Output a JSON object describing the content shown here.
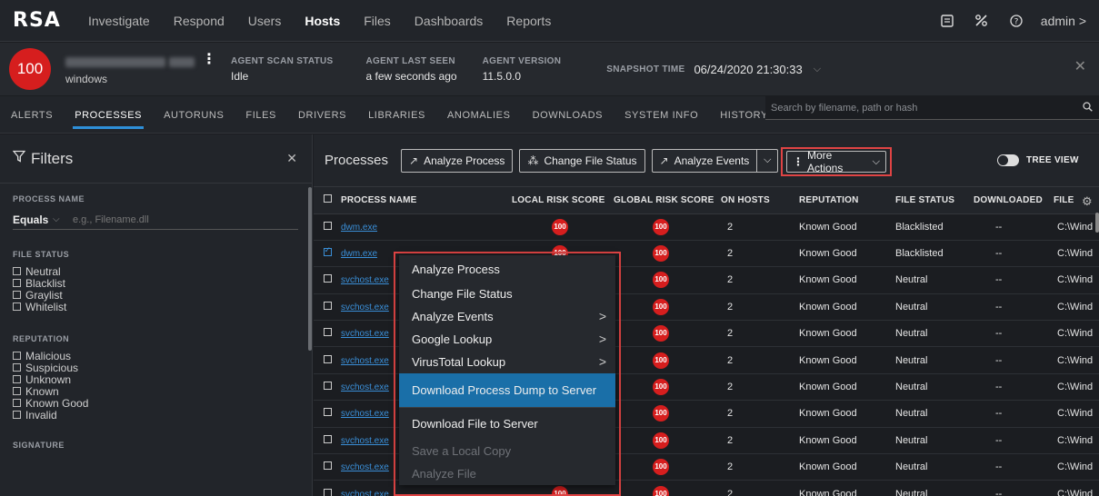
{
  "app": {
    "logo": "RSA",
    "nav": [
      "Investigate",
      "Respond",
      "Users",
      "Hosts",
      "Files",
      "Dashboards",
      "Reports"
    ],
    "active_nav": "Hosts",
    "user": "admin >"
  },
  "host": {
    "risk_score": "100",
    "os": "windows",
    "agent_scan_status": {
      "label": "AGENT SCAN STATUS",
      "value": "Idle"
    },
    "agent_last_seen": {
      "label": "AGENT LAST SEEN",
      "value": "a few seconds ago"
    },
    "agent_version": {
      "label": "AGENT VERSION",
      "value": "11.5.0.0"
    },
    "snapshot": {
      "label": "SNAPSHOT TIME",
      "value": "06/24/2020 21:30:33"
    }
  },
  "tabs": [
    "ALERTS",
    "PROCESSES",
    "AUTORUNS",
    "FILES",
    "DRIVERS",
    "LIBRARIES",
    "ANOMALIES",
    "DOWNLOADS",
    "SYSTEM INFO",
    "HISTORY"
  ],
  "active_tab": "PROCESSES",
  "search": {
    "placeholder": "Search by filename, path or hash"
  },
  "filters": {
    "title": "Filters",
    "process_name": {
      "label": "PROCESS NAME",
      "operator": "Equals",
      "placeholder": "e.g., Filename.dll"
    },
    "file_status": {
      "label": "FILE STATUS",
      "options": [
        "Neutral",
        "Blacklist",
        "Graylist",
        "Whitelist"
      ]
    },
    "reputation": {
      "label": "REPUTATION",
      "options": [
        "Malicious",
        "Suspicious",
        "Unknown",
        "Known",
        "Known Good",
        "Invalid"
      ]
    },
    "signature_label": "SIGNATURE"
  },
  "processes": {
    "title": "Processes",
    "buttons": {
      "analyze_process": "Analyze Process",
      "change_file_status": "Change File Status",
      "analyze_events": "Analyze Events",
      "more_actions": "More Actions"
    },
    "tree_view": "TREE VIEW",
    "columns": [
      "PROCESS NAME",
      "LOCAL RISK SCORE",
      "GLOBAL RISK SCORE",
      "ON HOSTS",
      "REPUTATION",
      "FILE STATUS",
      "DOWNLOADED",
      "FILE"
    ],
    "rows": [
      {
        "name": "dwm.exe",
        "local": "100",
        "global": "100",
        "hosts": "2",
        "rep": "Known Good",
        "status": "Blacklisted",
        "dl": "--",
        "path": "C:\\Wind",
        "checked": false
      },
      {
        "name": "dwm.exe",
        "local": "100",
        "global": "100",
        "hosts": "2",
        "rep": "Known Good",
        "status": "Blacklisted",
        "dl": "--",
        "path": "C:\\Wind",
        "checked": true
      },
      {
        "name": "svchost.exe",
        "local": "100",
        "global": "100",
        "hosts": "2",
        "rep": "Known Good",
        "status": "Neutral",
        "dl": "--",
        "path": "C:\\Wind",
        "checked": false
      },
      {
        "name": "svchost.exe",
        "local": "100",
        "global": "100",
        "hosts": "2",
        "rep": "Known Good",
        "status": "Neutral",
        "dl": "--",
        "path": "C:\\Wind",
        "checked": false
      },
      {
        "name": "svchost.exe",
        "local": "100",
        "global": "100",
        "hosts": "2",
        "rep": "Known Good",
        "status": "Neutral",
        "dl": "--",
        "path": "C:\\Wind",
        "checked": false
      },
      {
        "name": "svchost.exe",
        "local": "100",
        "global": "100",
        "hosts": "2",
        "rep": "Known Good",
        "status": "Neutral",
        "dl": "--",
        "path": "C:\\Wind",
        "checked": false
      },
      {
        "name": "svchost.exe",
        "local": "100",
        "global": "100",
        "hosts": "2",
        "rep": "Known Good",
        "status": "Neutral",
        "dl": "--",
        "path": "C:\\Wind",
        "checked": false
      },
      {
        "name": "svchost.exe",
        "local": "100",
        "global": "100",
        "hosts": "2",
        "rep": "Known Good",
        "status": "Neutral",
        "dl": "--",
        "path": "C:\\Wind",
        "checked": false
      },
      {
        "name": "svchost.exe",
        "local": "100",
        "global": "100",
        "hosts": "2",
        "rep": "Known Good",
        "status": "Neutral",
        "dl": "--",
        "path": "C:\\Wind",
        "checked": false
      },
      {
        "name": "svchost.exe",
        "local": "100",
        "global": "100",
        "hosts": "2",
        "rep": "Known Good",
        "status": "Neutral",
        "dl": "--",
        "path": "C:\\Wind",
        "checked": false
      },
      {
        "name": "svchost.exe",
        "local": "100",
        "global": "100",
        "hosts": "2",
        "rep": "Known Good",
        "status": "Neutral",
        "dl": "--",
        "path": "C:\\Wind",
        "checked": false
      }
    ]
  },
  "context_menu": {
    "items": [
      {
        "label": "Analyze Process",
        "submenu": false,
        "disabled": false,
        "highlighted": false
      },
      {
        "label": "Change File Status",
        "submenu": false,
        "disabled": false,
        "highlighted": false
      },
      {
        "label": "Analyze Events",
        "submenu": true,
        "disabled": false,
        "highlighted": false
      },
      {
        "label": "Google Lookup",
        "submenu": true,
        "disabled": false,
        "highlighted": false
      },
      {
        "label": "VirusTotal Lookup",
        "submenu": true,
        "disabled": false,
        "highlighted": false
      },
      {
        "label": "Download Process Dump to Server",
        "submenu": false,
        "disabled": false,
        "highlighted": true
      },
      {
        "label": "Download File to Server",
        "submenu": false,
        "disabled": false,
        "highlighted": false
      },
      {
        "label": "Save a Local Copy",
        "submenu": false,
        "disabled": true,
        "highlighted": false
      },
      {
        "label": "Analyze File",
        "submenu": false,
        "disabled": true,
        "highlighted": false
      }
    ]
  },
  "colors": {
    "accent": "#2e8fd8",
    "risk": "#d61e1e",
    "highlight_frame": "#e04444",
    "menu_highlight": "#1a6fa8"
  }
}
